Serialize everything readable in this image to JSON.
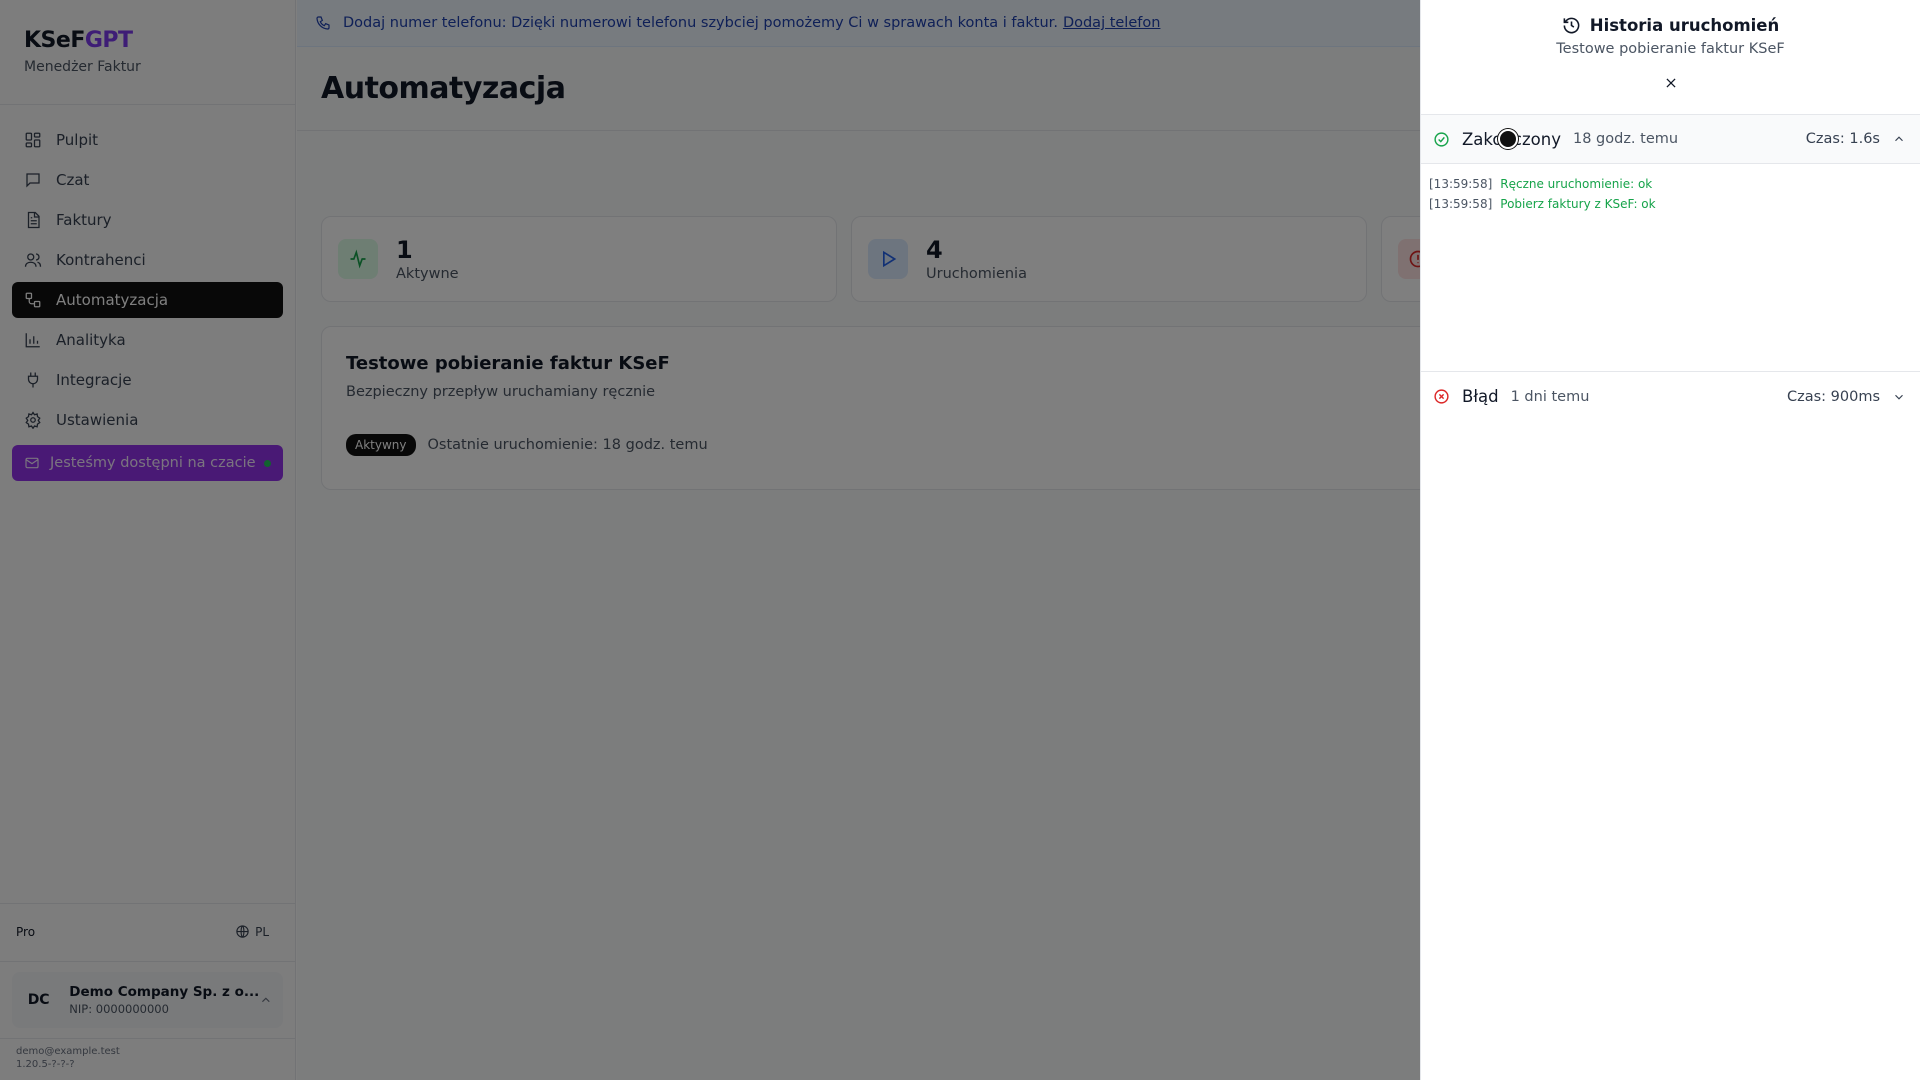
{
  "brand": {
    "name_part1": "KSeF",
    "name_part2": "GPT",
    "subtitle": "Menedżer Faktur"
  },
  "colors": {
    "brand_accent": "#7c3aed",
    "active_nav": "#111111",
    "chat_cta": "#9333ea",
    "success": "#16a34a",
    "error": "#dc2626"
  },
  "sidebar": {
    "items": [
      {
        "label": "Pulpit",
        "icon": "dashboard-icon"
      },
      {
        "label": "Czat",
        "icon": "chat-icon"
      },
      {
        "label": "Faktury",
        "icon": "document-icon"
      },
      {
        "label": "Kontrahenci",
        "icon": "users-icon"
      },
      {
        "label": "Automatyzacja",
        "icon": "workflow-icon",
        "active": true
      },
      {
        "label": "Analityka",
        "icon": "bar-chart-icon"
      },
      {
        "label": "Integracje",
        "icon": "plug-icon"
      },
      {
        "label": "Ustawienia",
        "icon": "gear-icon"
      }
    ],
    "chat_cta": "Jesteśmy dostępni na czacie",
    "plan": "Pro",
    "language": "PL",
    "company": {
      "initials": "DC",
      "name": "Demo Company Sp. z o...",
      "nip": "NIP: 0000000000"
    },
    "user_email": "demo@example.test",
    "version": "1.20.5-?-?-?"
  },
  "banner": {
    "text": "Dodaj numer telefonu: Dzięki numerowi telefonu szybciej pomożemy Ci w sprawach konta i faktur.",
    "link": "Dodaj telefon"
  },
  "page": {
    "title": "Automatyzacja"
  },
  "stats": [
    {
      "value": "1",
      "label": "Aktywne",
      "icon": "activity-icon"
    },
    {
      "value": "4",
      "label": "Uruchomienia",
      "icon": "play-icon"
    }
  ],
  "flow": {
    "title": "Testowe pobieranie faktur KSeF",
    "description": "Bezpieczny przepływ uruchamiany ręcznie",
    "badge": "Aktywny",
    "last_run": "Ostatnie uruchomienie: 18 godz. temu"
  },
  "drawer": {
    "title": "Historia uruchomień",
    "subtitle": "Testowe pobieranie faktur KSeF",
    "runs": [
      {
        "status": "Zakończony",
        "ago": "18 godz. temu",
        "duration": "Czas: 1.6s",
        "expanded": true,
        "logs": [
          {
            "time": "[13:59:58]",
            "message": "Ręczne uruchomienie: ok"
          },
          {
            "time": "[13:59:58]",
            "message": "Pobierz faktury z KSeF: ok"
          }
        ]
      },
      {
        "status": "Błąd",
        "ago": "1 dni temu",
        "duration": "Czas: 900ms",
        "expanded": false
      }
    ]
  }
}
